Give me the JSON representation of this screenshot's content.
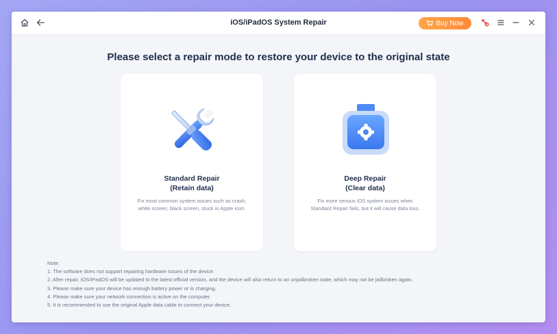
{
  "titlebar": {
    "title": "iOS/iPadOS System Repair",
    "buy_label": "Buy Now",
    "icons": [
      "home-icon",
      "back-arrow-icon",
      "cart-icon",
      "feedback-icon",
      "menu-icon",
      "minimize-icon",
      "close-icon"
    ]
  },
  "main": {
    "heading": "Please select a repair mode to restore your device to the original state",
    "cards": [
      {
        "title_line1": "Standard Repair",
        "title_line2": "(Retain data)",
        "desc_line1": "Fix most common system issues such as crash,",
        "desc_line2": "white screen, black screen, stuck in Apple icon.",
        "icon": "wrench-screwdriver-icon"
      },
      {
        "title_line1": "Deep Repair",
        "title_line2": "(Clear data)",
        "desc_line1": "Fix more serious iOS system issues when",
        "desc_line2": "Standard Repair fails, but it will cause data loss.",
        "icon": "toolbox-icon"
      }
    ]
  },
  "notes": {
    "header": "Note:",
    "items": [
      "1. The software does not support repairing hardware issues of the device.",
      "2. After repair, iOS/iPadOS will be updated to the latest official version, and the device will also return to an unjailbroken state, which may not be jailbroken again.",
      "3. Please make sure your device has enough battery power or is charging.",
      "4. Please make sure your network connection is active on the computer.",
      "5. It is recommended to use the original Apple data cable to connect your device."
    ]
  },
  "colors": {
    "accent_orange": "#ff8a3a",
    "primary_blue": "#3f7df5",
    "text_dark": "#1f2d4a",
    "background": "#f3f5f9"
  }
}
